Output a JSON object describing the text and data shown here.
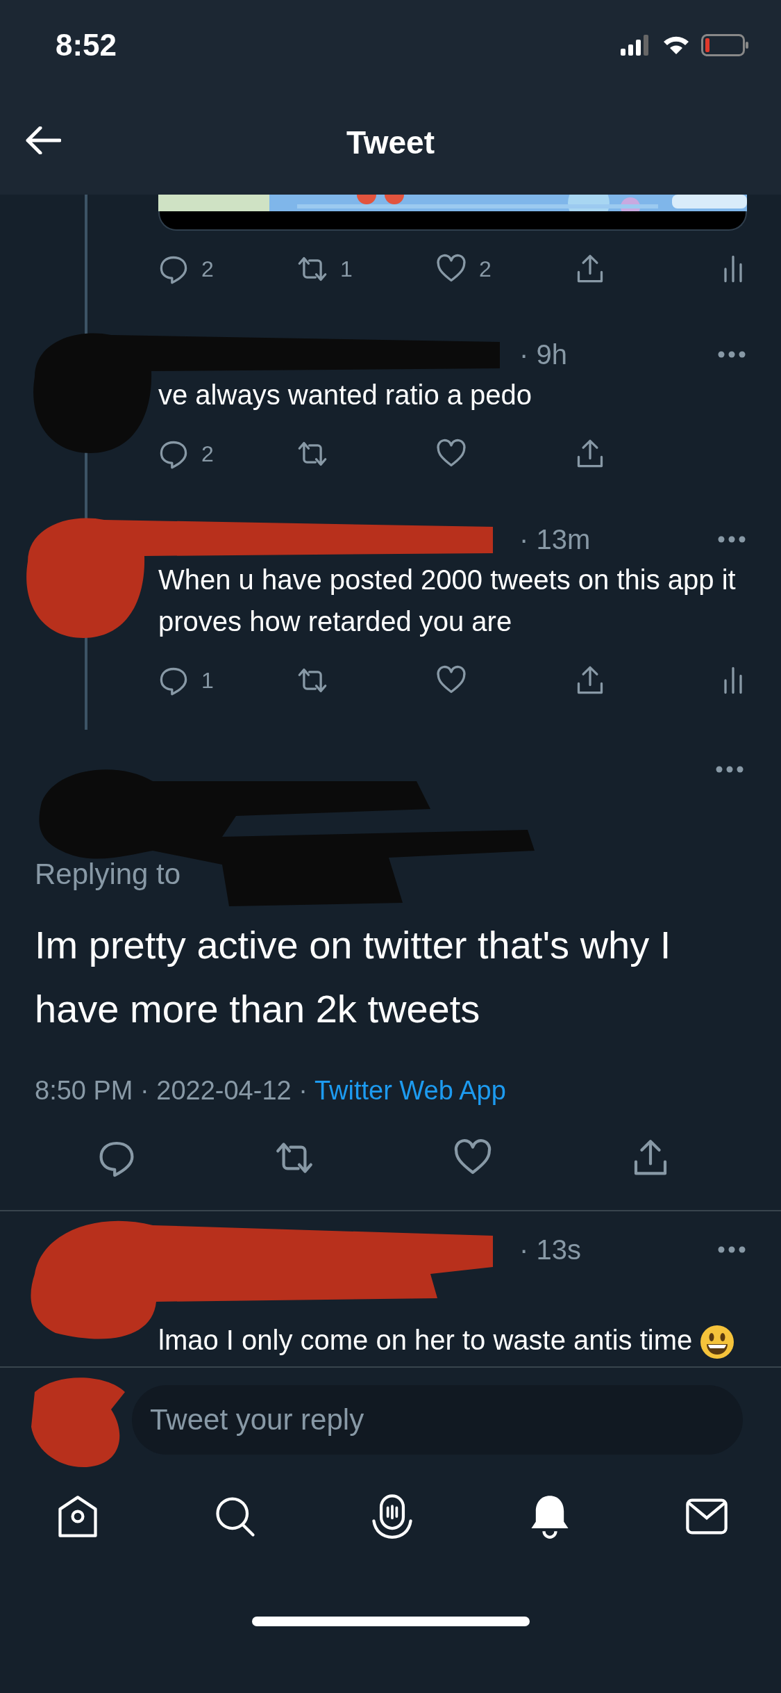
{
  "status_bar": {
    "time": "8:52"
  },
  "header": {
    "title": "Tweet"
  },
  "parent_actions": {
    "reply_count": "2",
    "retweet_count": "1",
    "like_count": "2",
    "show_analytics": true
  },
  "thread_replies": [
    {
      "time": "· 9h",
      "text": "ve always wanted ratio a pedo",
      "actions": {
        "reply_count": "2",
        "show_analytics": false
      }
    },
    {
      "time": "· 13m",
      "text": "When u have posted 2000 tweets on this app it proves how retarded you are",
      "actions": {
        "reply_count": "1",
        "show_analytics": true
      }
    }
  ],
  "main_tweet": {
    "replying_label": "Replying to",
    "text": "Im pretty active on twitter that's why I have more than 2k tweets",
    "timestamp": "8:50 PM · 2022-04-12 ·",
    "source": "Twitter Web App"
  },
  "latest_reply": {
    "time": "· 13s",
    "text": "lmao I only come on her to waste antis time"
  },
  "composer": {
    "placeholder": "Tweet your reply"
  }
}
